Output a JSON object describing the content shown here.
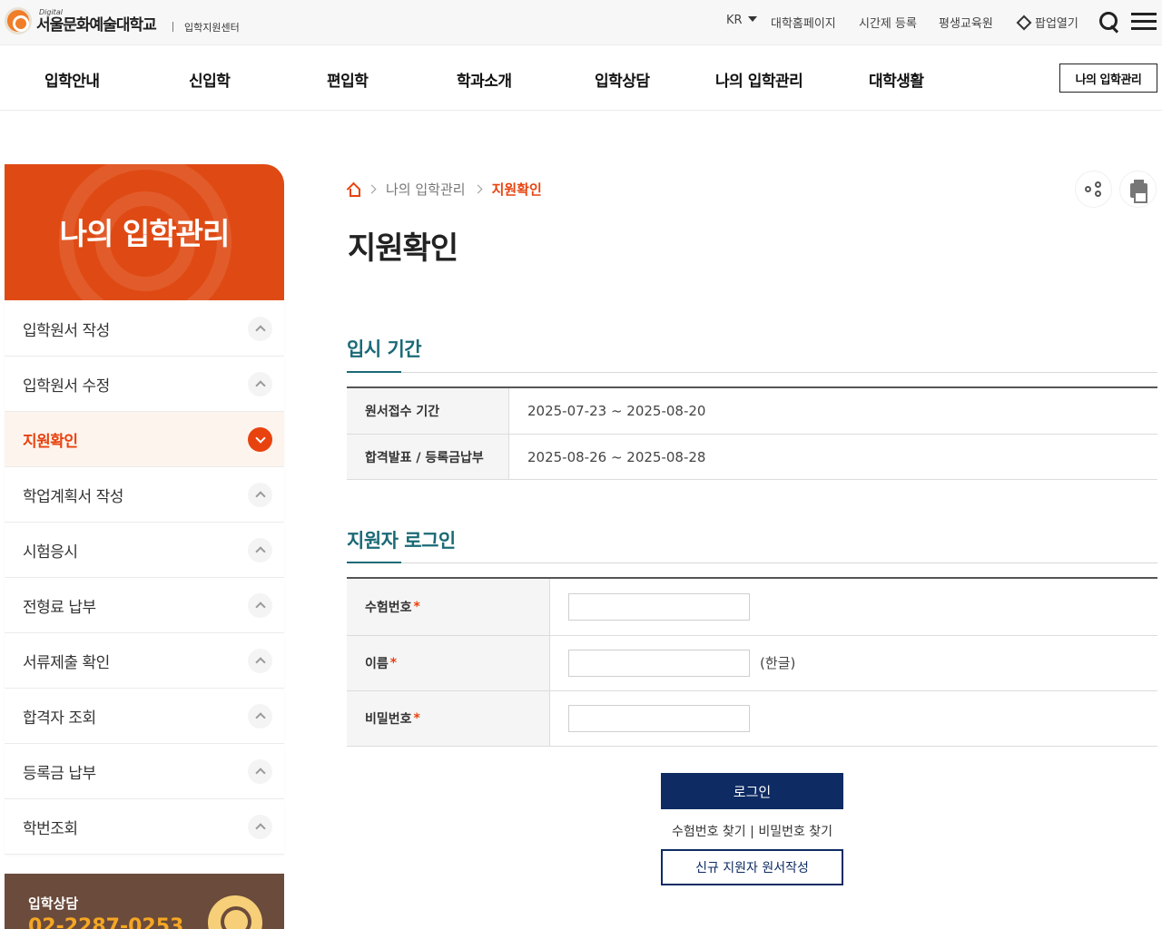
{
  "header": {
    "logo_small": "Digital",
    "logo_name": "서울문화예술대학교",
    "logo_sub": "입학지원센터",
    "utility": {
      "lang": "KR",
      "links": [
        "대학홈페이지",
        "시간제 등록",
        "평생교육원"
      ],
      "popup_label": "팝업열기"
    }
  },
  "nav": {
    "items": [
      "입학안내",
      "신입학",
      "편입학",
      "학과소개",
      "입학상담",
      "나의 입학관리",
      "대학생활"
    ],
    "my_button": "나의 입학관리"
  },
  "sidebar": {
    "title": "나의 입학관리",
    "items": [
      {
        "label": "입학원서 작성",
        "active": false
      },
      {
        "label": "입학원서 수정",
        "active": false
      },
      {
        "label": "지원확인",
        "active": true
      },
      {
        "label": "학업계획서 작성",
        "active": false
      },
      {
        "label": "시험응시",
        "active": false
      },
      {
        "label": "전형료 납부",
        "active": false
      },
      {
        "label": "서류제출 확인",
        "active": false
      },
      {
        "label": "합격자 조회",
        "active": false
      },
      {
        "label": "등록금 납부",
        "active": false
      },
      {
        "label": "학번조회",
        "active": false
      }
    ],
    "counsel": {
      "title": "입학상담",
      "phone": "02-2287-0253"
    }
  },
  "content": {
    "breadcrumb": [
      "나의 입학관리",
      "지원확인"
    ],
    "page_title": "지원확인",
    "period_section": {
      "title": "입시 기간",
      "rows": [
        {
          "label": "원서접수 기간",
          "value": "2025-07-23 ~ 2025-08-20"
        },
        {
          "label": "합격발표 / 등록금납부",
          "value": "2025-08-26 ~ 2025-08-28"
        }
      ]
    },
    "login_section": {
      "title": "지원자 로그인",
      "fields": [
        {
          "label": "수험번호",
          "required_mark": "*",
          "value": "",
          "hint": ""
        },
        {
          "label": "이름",
          "required_mark": "*",
          "value": "",
          "hint": "(한글)"
        },
        {
          "label": "비밀번호",
          "required_mark": "*",
          "value": "",
          "hint": ""
        }
      ],
      "login_button": "로그인",
      "find_exam_no": "수험번호 찾기",
      "find_sep": "|",
      "find_password": "비밀번호 찾기",
      "new_applicant_button": "신규 지원자 원서작성"
    }
  },
  "colors": {
    "accent": "#e8430f",
    "teal": "#1a6a76",
    "navy": "#0e2b63",
    "counsel_bg": "#6b4b3b"
  }
}
